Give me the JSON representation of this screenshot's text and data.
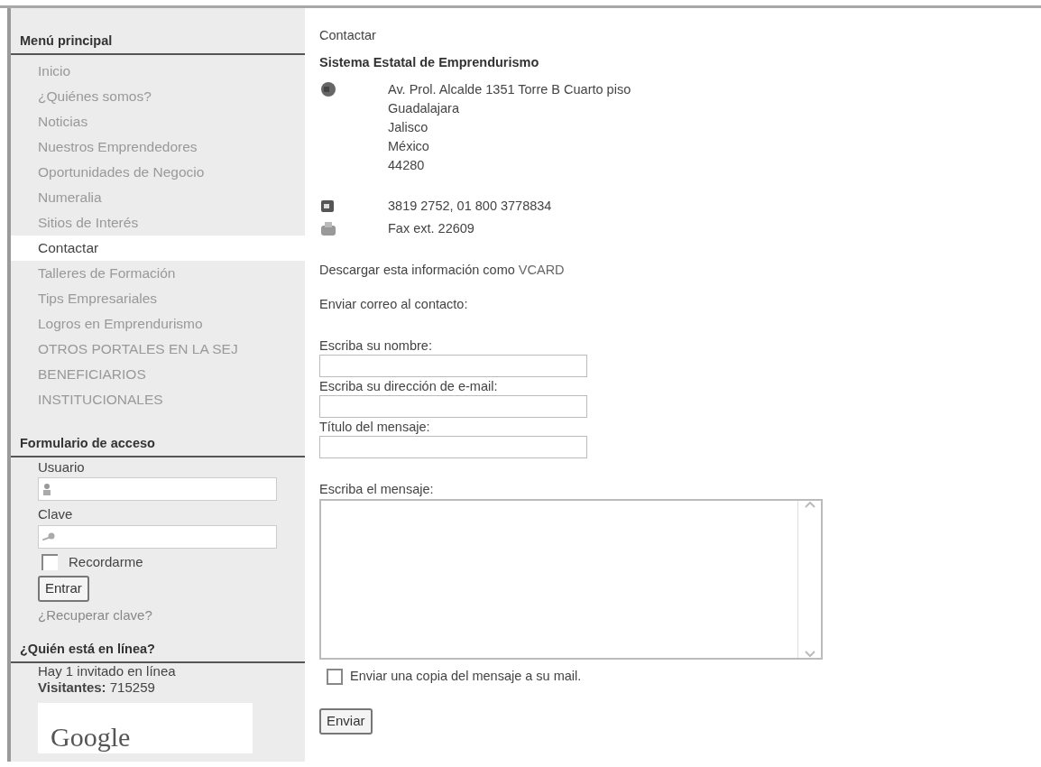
{
  "main_menu": {
    "title": "Menú principal",
    "items": [
      {
        "label": "Inicio",
        "selected": false
      },
      {
        "label": "¿Quiénes somos?",
        "selected": false
      },
      {
        "label": "Noticias",
        "selected": false
      },
      {
        "label": "Nuestros Emprendedores",
        "selected": false
      },
      {
        "label": "Oportunidades de Negocio",
        "selected": false
      },
      {
        "label": "Numeralia",
        "selected": false
      },
      {
        "label": "Sitios de Interés",
        "selected": false
      },
      {
        "label": "Contactar",
        "selected": true
      },
      {
        "label": "Talleres de Formación",
        "selected": false
      },
      {
        "label": "Tips Empresariales",
        "selected": false
      },
      {
        "label": "Logros en Emprendurismo",
        "selected": false
      },
      {
        "label": "OTROS PORTALES EN LA SEJ",
        "selected": false
      },
      {
        "label": "BENEFICIARIOS",
        "selected": false
      },
      {
        "label": "INSTITUCIONALES",
        "selected": false
      }
    ]
  },
  "login_form": {
    "title": "Formulario de acceso",
    "user_label": "Usuario",
    "password_label": "Clave",
    "remember": {
      "label": "Recordarme",
      "checked": false
    },
    "submit": "Entrar",
    "recover_link": "¿Recuperar clave?"
  },
  "online": {
    "title": "¿Quién está en línea?",
    "guests": "Hay 1 invitado en línea",
    "visitors_label": "Visitantes:",
    "visitors": "715259",
    "logo": "Google"
  },
  "contact": {
    "page_title": "Contactar",
    "name": "Sistema Estatal de Emprendurismo",
    "address": [
      "Av. Prol. Alcalde 1351 Torre B Cuarto piso",
      "Guadalajara",
      "Jalisco",
      "México",
      "44280"
    ],
    "phone": "3819 2752, 01 800 3778834",
    "fax": "Fax ext. 22609",
    "vcard_text": "Descargar esta información como",
    "vcard_link": "VCARD",
    "email_heading": "Enviar correo al contacto:",
    "fields": [
      {
        "label": "Escriba su nombre:"
      },
      {
        "label": "Escriba su dirección de e-mail:"
      },
      {
        "label": "Título del mensaje:"
      }
    ],
    "message_label": "Escriba el mensaje:",
    "copy": {
      "label": "Enviar una copia del mensaje a su mail.",
      "checked": false
    },
    "submit": "Enviar"
  }
}
